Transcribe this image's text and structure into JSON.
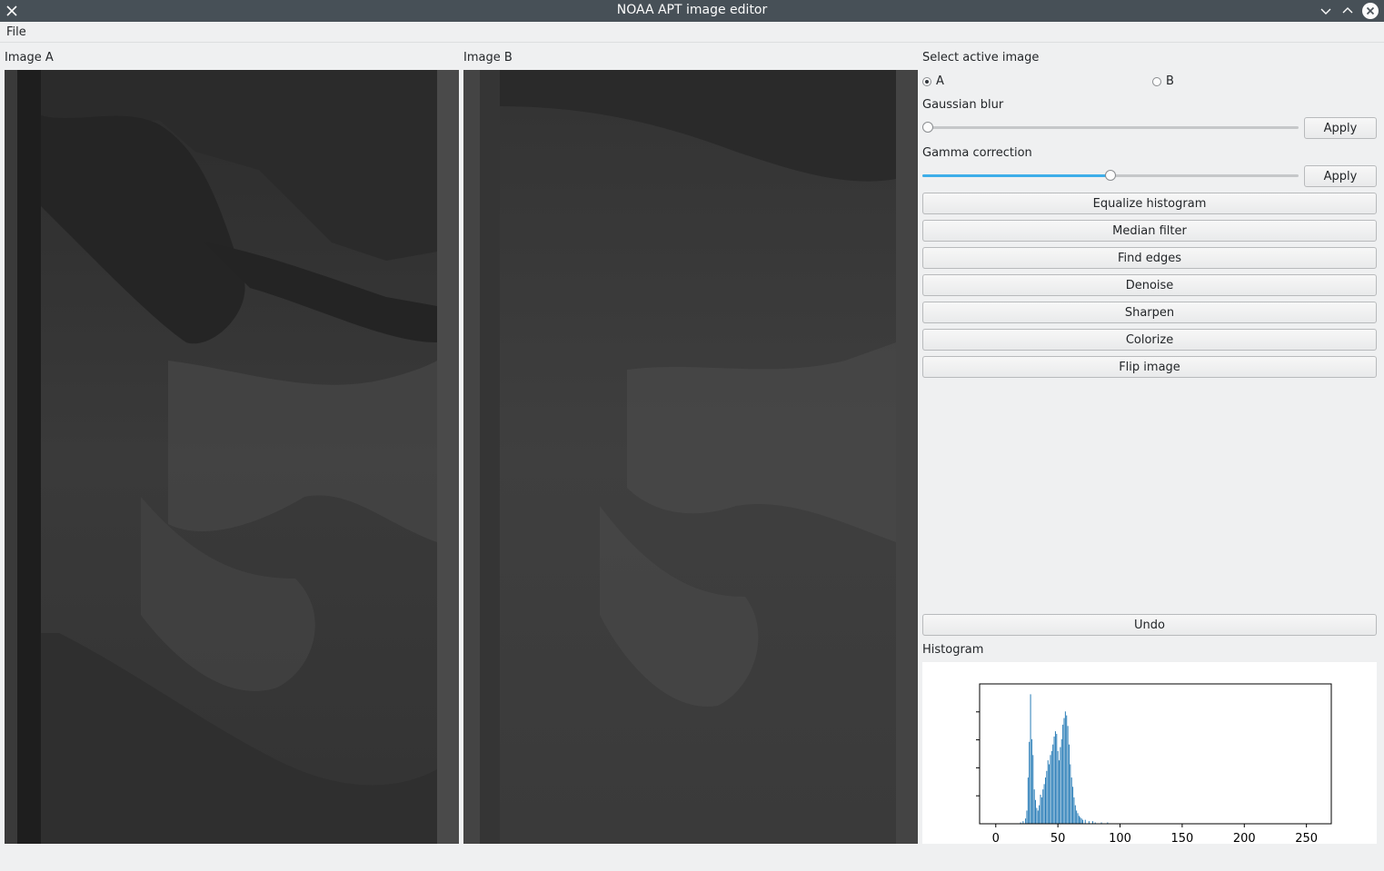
{
  "window": {
    "title": "NOAA APT image editor"
  },
  "menu": {
    "file": "File"
  },
  "panels": {
    "image_a": "Image A",
    "image_b": "Image B"
  },
  "controls": {
    "select_active_label": "Select active image",
    "radio_a": "A",
    "radio_b": "B",
    "active": "A",
    "gaussian_label": "Gaussian blur",
    "gaussian_value": 0.0,
    "gamma_label": "Gamma correction",
    "gamma_value": 0.5,
    "apply_label": "Apply",
    "buttons": [
      "Equalize histogram",
      "Median filter",
      "Find edges",
      "Denoise",
      "Sharpen",
      "Colorize",
      "Flip image"
    ],
    "undo_label": "Undo",
    "histogram_label": "Histogram"
  },
  "colors": {
    "accent": "#3daee9",
    "bar": "#1f77b4",
    "titlebar": "#475057"
  },
  "chart_data": {
    "type": "bar",
    "title": "",
    "xlabel": "",
    "ylabel": "",
    "xlim": [
      -13,
      270
    ],
    "xticks": [
      0,
      50,
      100,
      150,
      200,
      250
    ],
    "yticks_labels_shown": false,
    "x": [
      20,
      22,
      24,
      25,
      26,
      27,
      28,
      29,
      30,
      31,
      32,
      33,
      34,
      35,
      36,
      37,
      38,
      39,
      40,
      41,
      42,
      43,
      44,
      45,
      46,
      47,
      48,
      49,
      50,
      51,
      52,
      53,
      54,
      55,
      56,
      57,
      58,
      59,
      60,
      61,
      62,
      63,
      64,
      65,
      66,
      67,
      68,
      69,
      70,
      72,
      75,
      78,
      80,
      85,
      90
    ],
    "values": [
      1,
      2,
      4,
      10,
      35,
      62,
      98,
      64,
      52,
      26,
      18,
      12,
      10,
      14,
      22,
      20,
      26,
      30,
      35,
      40,
      48,
      45,
      52,
      55,
      60,
      66,
      70,
      68,
      55,
      48,
      58,
      64,
      75,
      80,
      85,
      82,
      74,
      60,
      45,
      35,
      28,
      20,
      14,
      10,
      8,
      6,
      5,
      4,
      3,
      3,
      2,
      2,
      1,
      1,
      1
    ]
  }
}
